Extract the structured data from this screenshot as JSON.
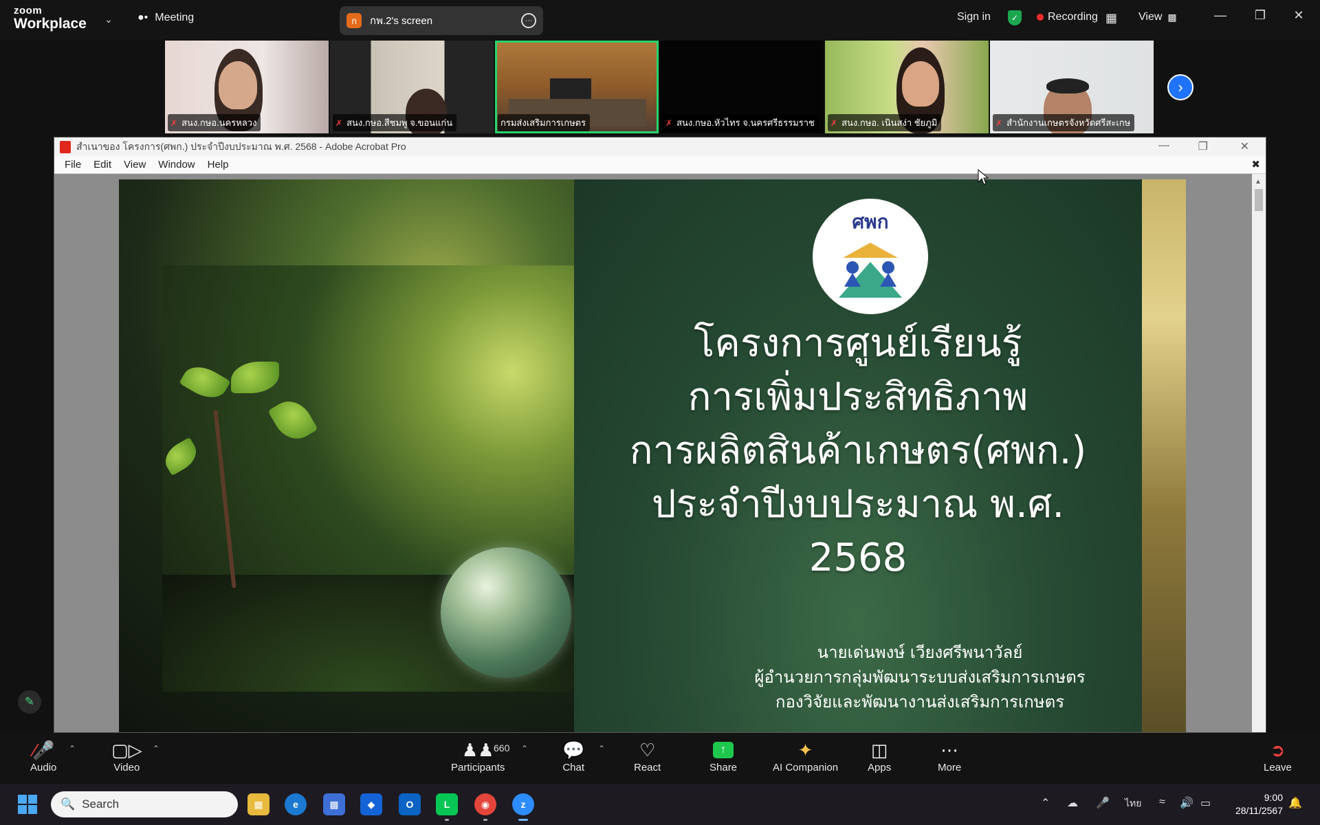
{
  "topbar": {
    "logo_top": "zoom",
    "logo_bottom": "Workplace",
    "meeting_label": "Meeting",
    "share_pill": {
      "badge": "ก",
      "label": "กพ.2's screen"
    },
    "sign_in": "Sign in",
    "recording": "Recording",
    "view": "View"
  },
  "thumbnails": [
    {
      "name": "สนง.กษอ.นครหลวง",
      "muted": true
    },
    {
      "name": "สนง.กษอ.สีชมพู จ.ขอนแก่น",
      "muted": true
    },
    {
      "name": "กรมส่งเสริมการเกษตร",
      "muted": false,
      "active": true
    },
    {
      "name": "สนง.กษอ.หัวไทร จ.นครศรีธรรมราช",
      "muted": true
    },
    {
      "name": "สนง.กษอ. เนินสง่า ชัยภูมิ",
      "muted": true
    },
    {
      "name": "สำนักงานเกษตรจังหวัดศรีสะเกษ",
      "muted": true
    }
  ],
  "acrobat": {
    "title": "สำเนาของ โครงการ(ศพก.) ประจำปีงบประมาณ พ.ศ. 2568 - Adobe Acrobat Pro",
    "menu": [
      "File",
      "Edit",
      "View",
      "Window",
      "Help"
    ]
  },
  "slide": {
    "emblem_text": "ศพก",
    "title_lines": [
      "โครงการศูนย์เรียนรู้",
      "การเพิ่มประสิทธิภาพ",
      "การผลิตสินค้าเกษตร(ศพก.)",
      "ประจำปีงบประมาณ พ.ศ.",
      "2568"
    ],
    "presenter_lines": [
      "นายเด่นพงษ์ เวียงศรีพนาวัลย์",
      "ผู้อำนวยการกลุ่มพัฒนาระบบส่งเสริมการเกษตร",
      "กองวิจัยและพัฒนางานส่งเสริมการเกษตร"
    ]
  },
  "toolbar": {
    "audio": "Audio",
    "video": "Video",
    "participants": "Participants",
    "participants_count": "660",
    "chat": "Chat",
    "react": "React",
    "share": "Share",
    "ai_companion": "AI Companion",
    "apps": "Apps",
    "more": "More",
    "leave": "Leave"
  },
  "taskbar": {
    "search_placeholder": "Search",
    "language": "ไทย",
    "time": "9:00",
    "date": "28/11/2567"
  }
}
